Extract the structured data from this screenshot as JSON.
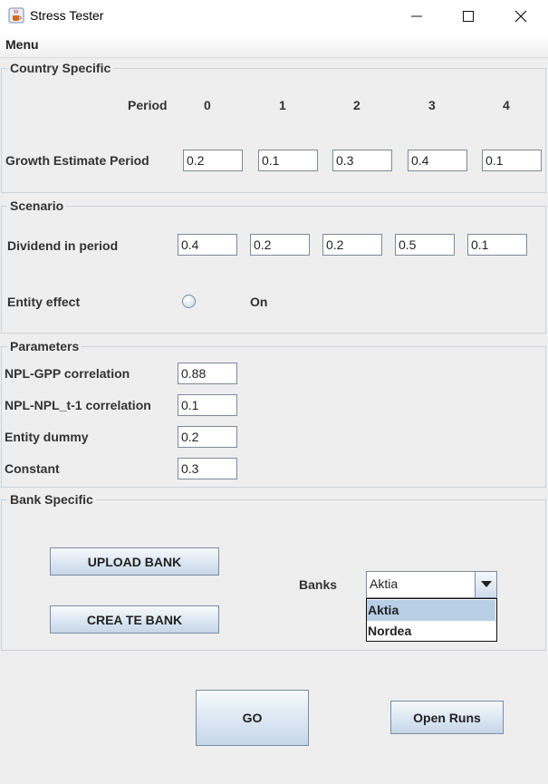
{
  "window": {
    "title": "Stress Tester"
  },
  "menu": {
    "items": [
      "Menu"
    ]
  },
  "country": {
    "title": "Country Specific",
    "period_label": "Period",
    "periods": [
      "0",
      "1",
      "2",
      "3",
      "4"
    ],
    "growth_label": "Growth Estimate Period",
    "growth_values": [
      "0.2",
      "0.1",
      "0.3",
      "0.4",
      "0.1"
    ]
  },
  "scenario": {
    "title": "Scenario",
    "dividend_label": "Dividend in period",
    "dividend_values": [
      "0.4",
      "0.2",
      "0.2",
      "0.5",
      "0.1"
    ],
    "entity_label": "Entity effect",
    "entity_radio_label": "On"
  },
  "parameters": {
    "title": "Parameters",
    "rows": [
      {
        "label": "NPL-GPP correlation",
        "value": "0.88"
      },
      {
        "label": "NPL-NPL_t-1 correlation",
        "value": "0.1"
      },
      {
        "label": "Entity dummy",
        "value": "0.2"
      },
      {
        "label": "Constant",
        "value": "0.3"
      }
    ]
  },
  "bank": {
    "title": "Bank Specific",
    "upload_label": "UPLOAD BANK",
    "create_label": "CREA TE BANK",
    "banks_label": "Banks",
    "selected": "Aktia",
    "options": [
      "Aktia",
      "Nordea"
    ]
  },
  "actions": {
    "go_label": "GO",
    "open_runs_label": "Open Runs"
  },
  "colors": {
    "button_gradient_top": "#f6f9fc",
    "button_gradient_bottom": "#c6d6e7",
    "border": "#c7d3e0",
    "selection": "#b8cfe5"
  }
}
